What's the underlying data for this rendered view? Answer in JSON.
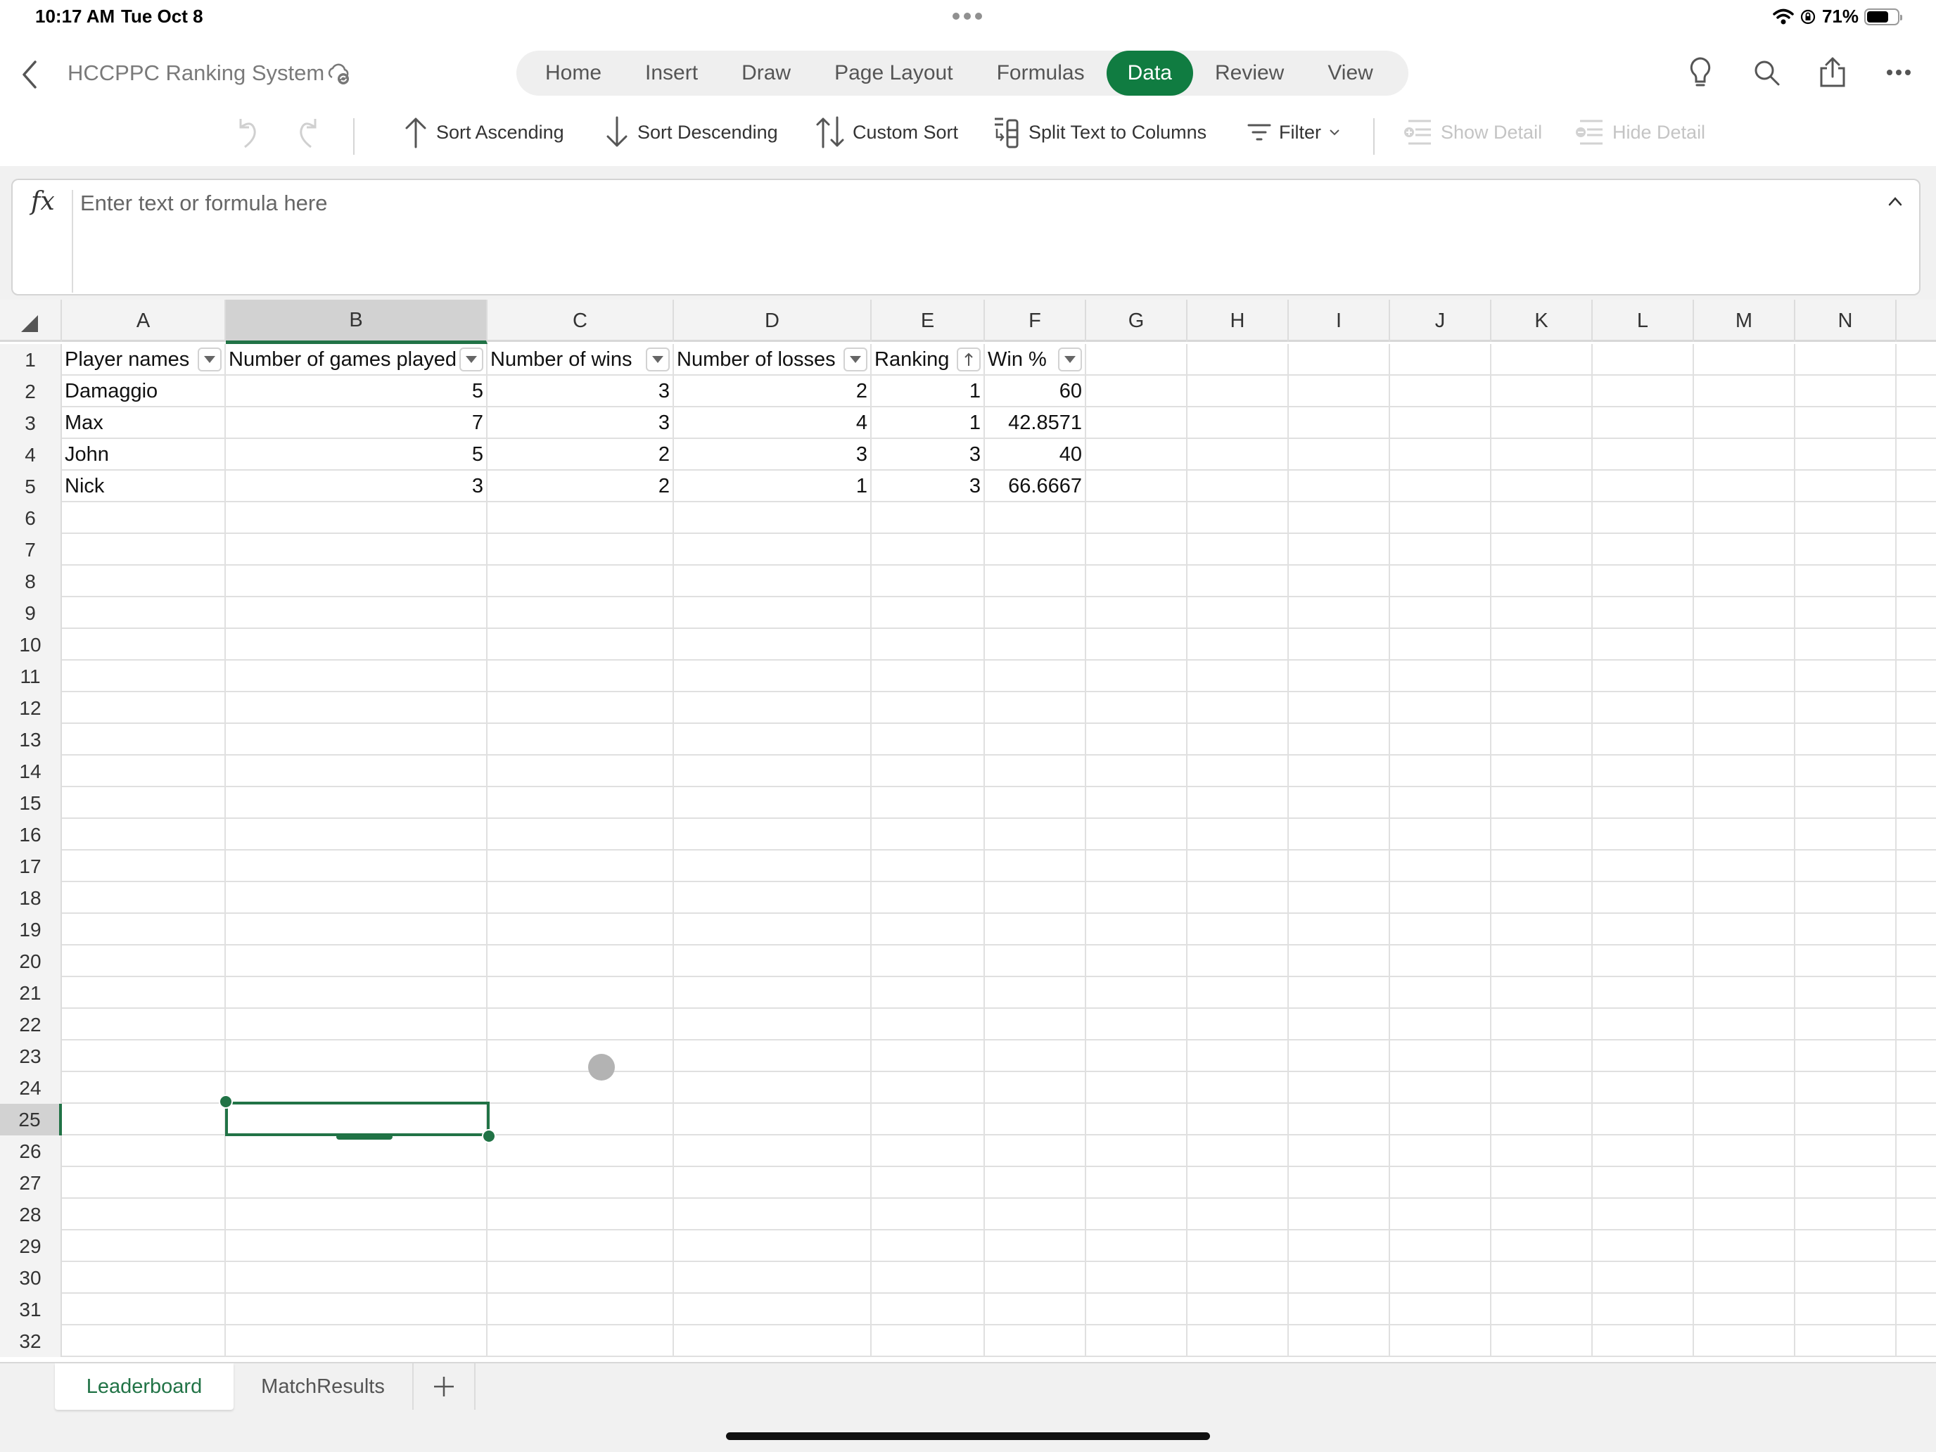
{
  "status_bar": {
    "time": "10:17 AM",
    "date": "Tue Oct 8",
    "battery_text": "71%",
    "battery_level": 0.71,
    "icons": [
      "wifi-icon",
      "orientation-lock-icon",
      "battery-icon"
    ]
  },
  "title_bar": {
    "back_icon": "chevron-left-icon",
    "document_title": "HCCPPC Ranking System",
    "sync_icon": "cloud-sync-icon",
    "right_icons": [
      "lightbulb-icon",
      "search-icon",
      "share-icon",
      "more-icon"
    ]
  },
  "ribbon_tabs": [
    {
      "label": "Home",
      "active": false
    },
    {
      "label": "Insert",
      "active": false
    },
    {
      "label": "Draw",
      "active": false
    },
    {
      "label": "Page Layout",
      "active": false
    },
    {
      "label": "Formulas",
      "active": false
    },
    {
      "label": "Data",
      "active": true
    },
    {
      "label": "Review",
      "active": false
    },
    {
      "label": "View",
      "active": false
    }
  ],
  "ribbon_commands": {
    "undo": "undo-icon",
    "redo": "redo-icon",
    "sort_ascending": "Sort Ascending",
    "sort_descending": "Sort Descending",
    "custom_sort": "Custom Sort",
    "split_text": "Split Text to Columns",
    "filter": "Filter",
    "show_detail": "Show Detail",
    "hide_detail": "Hide Detail"
  },
  "formula_bar": {
    "fx_label": "fx",
    "placeholder": "Enter text or formula here",
    "value": ""
  },
  "grid": {
    "columns": [
      "A",
      "B",
      "C",
      "D",
      "E",
      "F",
      "G",
      "H",
      "I",
      "J",
      "K",
      "L",
      "M",
      "N"
    ],
    "selected_column": "B",
    "selected_row": 25,
    "selected_cell": "B25",
    "row_numbers": [
      "1",
      "2",
      "3",
      "4",
      "5",
      "6",
      "7",
      "8",
      "9",
      "10",
      "11",
      "12",
      "13",
      "14",
      "15",
      "16",
      "17",
      "18",
      "19",
      "20",
      "21",
      "22",
      "23",
      "24",
      "25",
      "26",
      "27",
      "28",
      "29",
      "30",
      "31",
      "32"
    ],
    "table_headers": [
      {
        "label": "Player names",
        "filter": "dropdown"
      },
      {
        "label": "Number of games played",
        "filter": "dropdown"
      },
      {
        "label": "Number of wins",
        "filter": "dropdown"
      },
      {
        "label": "Number of losses",
        "filter": "dropdown"
      },
      {
        "label": "Ranking",
        "filter": "sorted-ascending"
      },
      {
        "label": "Win %",
        "filter": "dropdown"
      }
    ],
    "table_rows": [
      [
        "Damaggio",
        "5",
        "3",
        "2",
        "1",
        "60"
      ],
      [
        "Max",
        "7",
        "3",
        "4",
        "1",
        "42.8571"
      ],
      [
        "John",
        "5",
        "2",
        "3",
        "3",
        "40"
      ],
      [
        "Nick",
        "3",
        "2",
        "1",
        "3",
        "66.6667"
      ]
    ]
  },
  "sheet_tabs": [
    {
      "label": "Leaderboard",
      "active": true
    },
    {
      "label": "MatchResults",
      "active": false
    }
  ],
  "add_sheet_icon": "plus-icon",
  "colors": {
    "accent": "#107c41",
    "selection": "#217346"
  }
}
